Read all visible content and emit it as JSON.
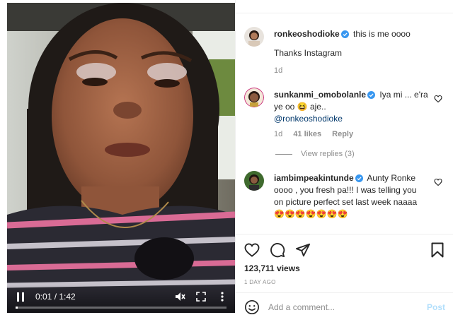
{
  "video": {
    "current_time": "0:01",
    "separator": " / ",
    "duration": "1:42",
    "progress": 0.01
  },
  "caption": {
    "username": "ronkeoshodioke",
    "text": "this is me oooo",
    "text2": "Thanks Instagram",
    "age": "1d"
  },
  "comments": [
    {
      "username": "sunkanmi_omobolanle",
      "text": "Iya mi ... e'ra ye oo 😆 aje..",
      "mention": "@ronkeoshodioke",
      "age": "1d",
      "likes": "41 likes",
      "reply": "Reply",
      "view_replies": "View replies (3)"
    },
    {
      "username": "iambimpeakintunde",
      "text": "Aunty Ronke oooo , you fresh pa!!! I was telling you on picture perfect set last week naaaa 😍😍😍😍😍😍😍"
    }
  ],
  "stats": {
    "views": "123,711 views",
    "date": "1 DAY AGO"
  },
  "add_comment": {
    "placeholder": "Add a comment...",
    "post_label": "Post"
  },
  "colors": {
    "verified": "#3897f0",
    "link": "#00376b",
    "muted": "#8e8e8e",
    "post_disabled": "#b2dffc"
  },
  "icons": {
    "play_pause": "pause-icon",
    "mute": "muted-speaker-icon",
    "fullscreen": "fullscreen-icon",
    "more": "more-icon",
    "like": "heart-icon",
    "comment": "comment-icon",
    "share": "paper-plane-icon",
    "save": "bookmark-icon",
    "emoji": "smiley-icon"
  }
}
